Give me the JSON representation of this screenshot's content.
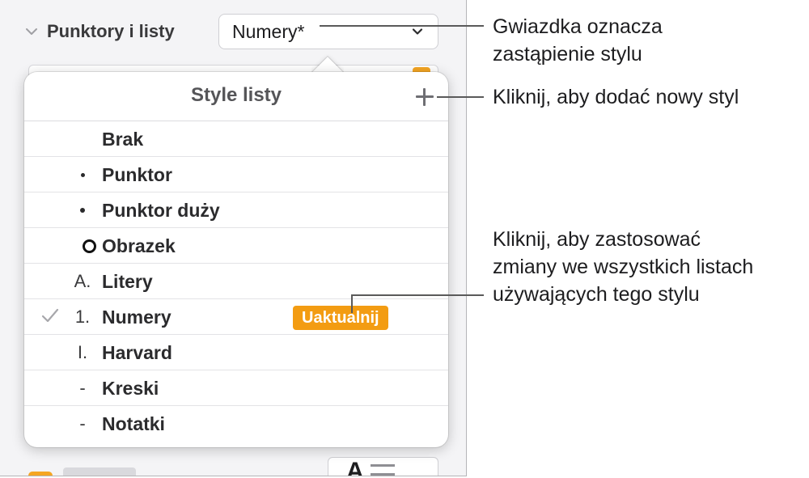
{
  "sidebar": {
    "section_title": "Punktory i listy",
    "style_select_value": "Numery*"
  },
  "popover": {
    "title": "Style listy",
    "add_icon": "plus-icon",
    "items": [
      {
        "marker": "",
        "label": "Brak"
      },
      {
        "marker": "",
        "label": "Punktor"
      },
      {
        "marker": "",
        "label": "Punktor duży"
      },
      {
        "marker": "",
        "label": "Obrazek"
      },
      {
        "marker": "A.",
        "label": "Litery"
      },
      {
        "marker": "1.",
        "label": "Numery",
        "selected": true
      },
      {
        "marker": "I.",
        "label": "Harvard"
      },
      {
        "marker": "-",
        "label": "Kreski"
      },
      {
        "marker": "-",
        "label": "Notatki"
      }
    ],
    "update_button": "Uaktualnij"
  },
  "callouts": {
    "asterisk_line1": "Gwiazdka oznacza",
    "asterisk_line2": "zastąpienie stylu",
    "add_style": "Kliknij, aby dodać nowy styl",
    "apply_line1": "Kliknij, aby zastosować",
    "apply_line2": "zmiany we wszystkich listach",
    "apply_line3": "używających tego stylu"
  },
  "colors": {
    "accent_orange": "#f39c12",
    "check_gray": "#a7a7ab"
  }
}
